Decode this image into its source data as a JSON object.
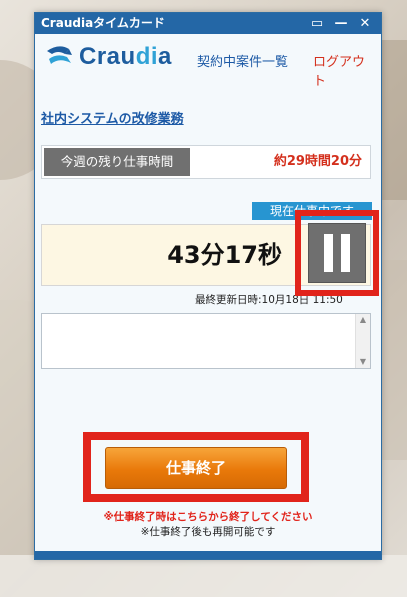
{
  "window": {
    "title": "Craudiaタイムカード"
  },
  "titlebar": {
    "restore_icon": "restore-icon",
    "minimize_icon": "minimize-icon",
    "close_icon": "close-icon"
  },
  "header": {
    "logo_prefix": "Crau",
    "logo_highlight": "di",
    "logo_suffix": "a",
    "nav_contracts": "契約中案件一覧",
    "nav_logout": "ログアウト"
  },
  "project": {
    "title": "社内システムの改修業務"
  },
  "remaining": {
    "label": "今週の残り仕事時間",
    "value": "約29時間20分"
  },
  "timer": {
    "status": "現在仕事中です",
    "elapsed": "43分17秒",
    "updated": "最終更新日時:10月18日 11:50"
  },
  "memo": {
    "value": ""
  },
  "actions": {
    "end_button": "仕事終了",
    "warning": "※仕事終了時はこちらから終了してください",
    "note": "※仕事終了後も再開可能です"
  },
  "colors": {
    "titlebar": "#2467a6",
    "accent_red": "#e1241b",
    "link_blue": "#1d5aa6",
    "button_orange": "#e9790a",
    "timer_bg": "#fdf7e3"
  }
}
